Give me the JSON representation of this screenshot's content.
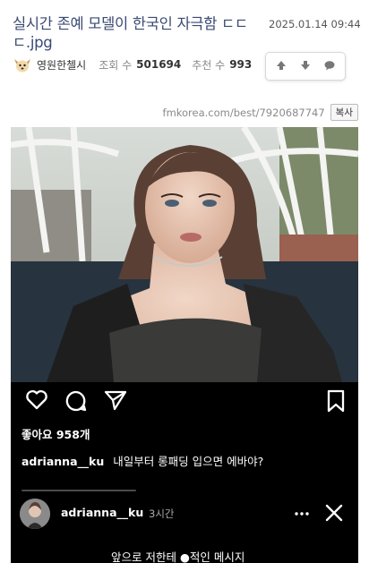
{
  "post": {
    "title": "실시간 존예 모델이 한국인 자극함 ㄷㄷㄷ.jpg",
    "date": "2025.01.14 09:44",
    "author": "영원한첼시",
    "views_label": "조회 수",
    "views": "501694",
    "recommend_label": "추천 수",
    "recommend": "993",
    "url": "fmkorea.com/best/7920687747",
    "copy_label": "복사"
  },
  "icons": {
    "avatar": "avatar-icon",
    "upvote": "arrow-up-icon",
    "downvote": "arrow-down-icon",
    "comment": "speech-bubble-icon",
    "like": "heart-icon",
    "reply": "comment-icon",
    "share": "send-icon",
    "save": "bookmark-icon",
    "more": "more-icon",
    "close": "close-icon"
  },
  "instagram": {
    "likes": "좋아요 958개",
    "caption_user": "adrianna__ku",
    "caption_text": "내일부터 롱패딩 입으면 에바야?",
    "story_user": "adrianna__ku",
    "story_time": "3시간",
    "subtitle": "앞으로 저한테 ●적인 메시지"
  },
  "colors": {
    "title": "#3a4a73",
    "instagram_bg": "#000000",
    "text_on_dark": "#ffffff"
  }
}
